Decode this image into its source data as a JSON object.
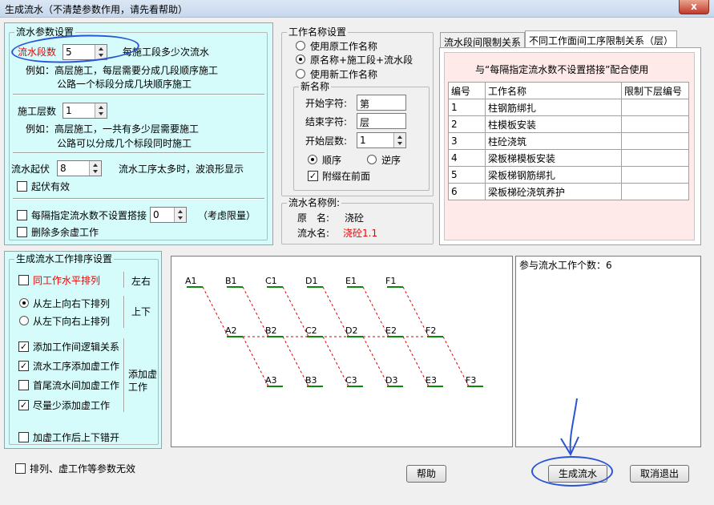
{
  "window": {
    "title": "生成流水（不清楚参数作用，请先看帮助）",
    "close": "x"
  },
  "params": {
    "group_title": "流水参数设置",
    "seg_label": "流水段数",
    "seg_value": "5",
    "seg_hint": "每施工段多少次流水",
    "seg_example_1": "例如：高层施工，每层需要分成几段顺序施工",
    "seg_example_2": "公路一个标段分成几块顺序施工",
    "floor_label": "施工层数",
    "floor_value": "1",
    "floor_example_1": "例如：高层施工，一共有多少层需要施工",
    "floor_example_2": "公路可以分成几个标段同时施工",
    "wave_label": "流水起伏",
    "wave_value": "8",
    "wave_hint": "流水工序太多时，波浪形显示",
    "wave_cb": "起伏有效",
    "interval_cb": "每隔指定流水数不设置搭接",
    "interval_value": "0",
    "interval_hint": "（考虑限量）",
    "delete_cb": "删除多余虚工作"
  },
  "names": {
    "group_title": "工作名称设置",
    "opt1": "使用原工作名称",
    "opt2": "原名称+施工段+流水段",
    "opt3": "使用新工作名称",
    "new_group": "新名称",
    "start_label": "开始字符:",
    "start_value": "第",
    "end_label": "结束字符:",
    "end_value": "层",
    "startfloor_label": "开始层数:",
    "startfloor_value": "1",
    "order1": "顺序",
    "order2": "逆序",
    "prefix_cb": "附缀在前面"
  },
  "example": {
    "group_title": "流水名称例:",
    "orig_label": "原　名:",
    "orig_value": "浇砼",
    "flow_label": "流水名:",
    "flow_value": "浇砼1.1"
  },
  "tabs": [
    "流水段间限制关系",
    "不同工作面间工序限制关系（层）"
  ],
  "limit_note": "与“每隔指定流水数不设置搭接”配合使用",
  "table": {
    "headers": [
      "编号",
      "工作名称",
      "限制下层编号"
    ],
    "rows": [
      [
        "1",
        "柱钢筋绑扎",
        ""
      ],
      [
        "2",
        "柱模板安装",
        ""
      ],
      [
        "3",
        "柱砼浇筑",
        ""
      ],
      [
        "4",
        "梁板梯模板安装",
        ""
      ],
      [
        "5",
        "梁板梯钢筋绑扎",
        ""
      ],
      [
        "6",
        "梁板梯砼浇筑养护",
        ""
      ]
    ]
  },
  "order": {
    "group_title": "生成流水工作排序设置",
    "same_h": "同工作水平排列",
    "lr": "左右",
    "r1": "从左上向右下排列",
    "r2": "从左下向右上排列",
    "ud": "上下",
    "c1": "添加工作间逻辑关系",
    "c2": "流水工序添加虚工作",
    "c3": "首尾流水间加虚工作",
    "c4": "尽量少添加虚工作",
    "dummy": "添加虚工作",
    "c5": "加虚工作后上下错开"
  },
  "diagram": {
    "rows": [
      [
        "A1",
        "B1",
        "C1",
        "D1",
        "E1",
        "F1"
      ],
      [
        "A2",
        "B2",
        "C2",
        "D2",
        "E2",
        "F2"
      ],
      [
        "A3",
        "B3",
        "C3",
        "D3",
        "E3",
        "F3"
      ]
    ]
  },
  "count_text": "参与流水工作个数：6",
  "bottom": {
    "invalid_cb": "排列、虚工作等参数无效",
    "help": "帮助",
    "generate": "生成流水",
    "cancel": "取消退出"
  }
}
